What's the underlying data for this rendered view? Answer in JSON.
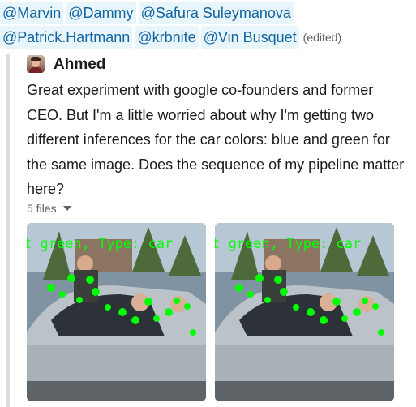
{
  "mentions": {
    "line1": [
      "@Marvin",
      "@Dammy",
      "@Safura Suleymanova"
    ],
    "line2": [
      "@Patrick.Hartmann",
      "@krbnite",
      "@Vin Busquet"
    ],
    "edited": "(edited)"
  },
  "message": {
    "author": "Ahmed",
    "text": "Great experiment with google co-founders and former CEO. But I'm a little worried about why I'm getting two different inferences for the car colors: blue and green for the same image. Does the sequence of my pipeline matter here?",
    "files_label": "5 files"
  },
  "attachments": [
    {
      "overlay_text": "t green, Type: car"
    },
    {
      "overlay_text": "t green, Type: car"
    }
  ],
  "colors": {
    "mention_bg": "#e8f5fa",
    "mention_text": "#1264a3",
    "overlay_green": "#00ff00"
  }
}
